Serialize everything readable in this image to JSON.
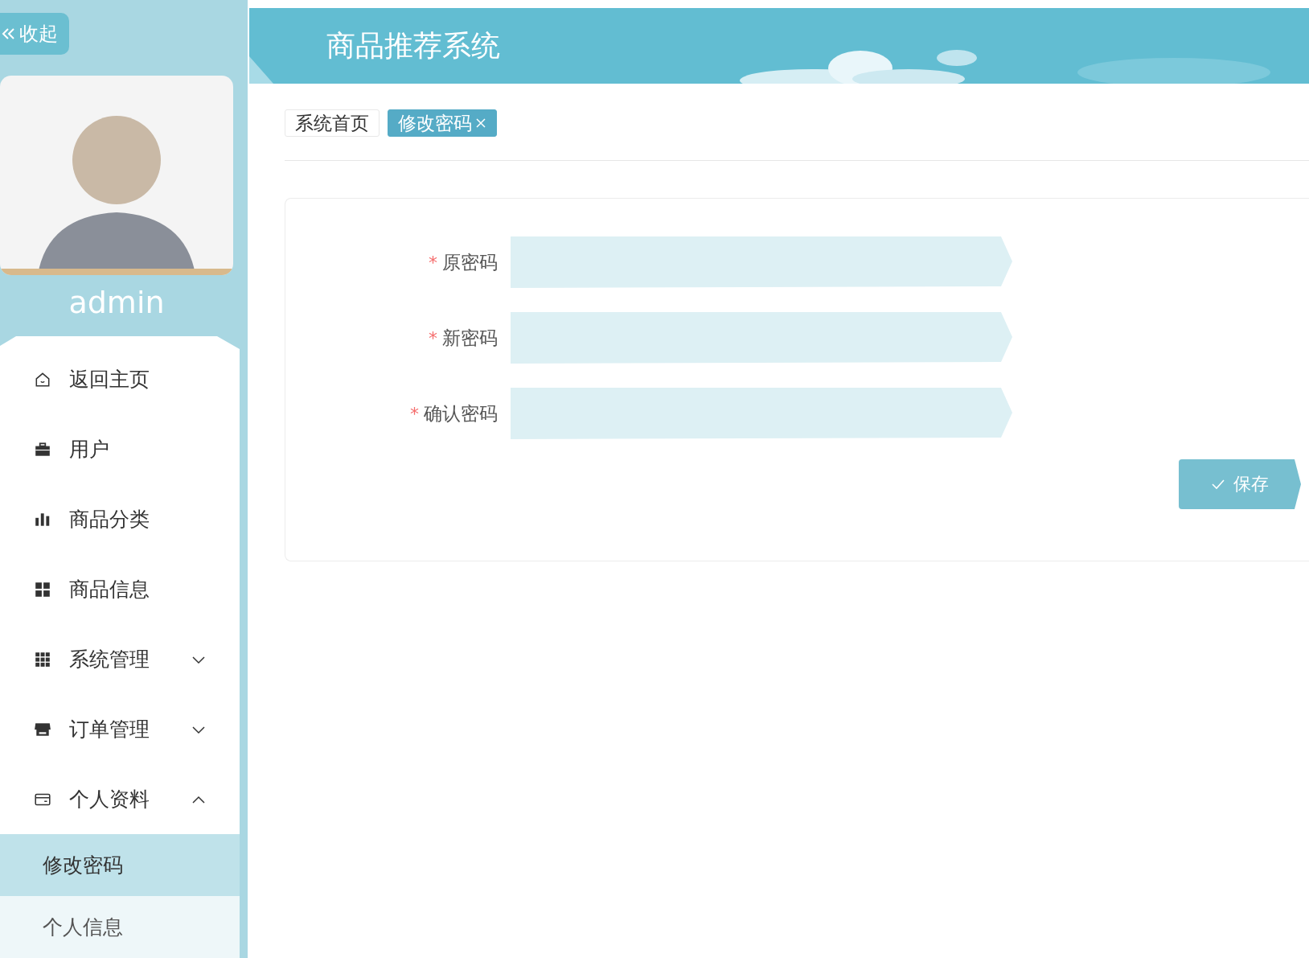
{
  "sidebar": {
    "collapse_button": {
      "label": "收起"
    },
    "user": {
      "name": "admin"
    },
    "menu": [
      {
        "label": "返回主页",
        "kind": "home"
      },
      {
        "label": "用户",
        "kind": "users"
      },
      {
        "label": "商品分类",
        "kind": "category"
      },
      {
        "label": "商品信息",
        "kind": "goods"
      },
      {
        "label": "系统管理",
        "kind": "system",
        "expanded": false
      },
      {
        "label": "订单管理",
        "kind": "orders",
        "expanded": false
      },
      {
        "label": "个人资料",
        "kind": "profile",
        "expanded": true,
        "children": [
          {
            "label": "修改密码",
            "selected": true
          },
          {
            "label": "个人信息",
            "selected": false
          }
        ]
      }
    ]
  },
  "header": {
    "title": "商品推荐系统"
  },
  "tabs": [
    {
      "label": "系统首页",
      "selected": false,
      "closable": false
    },
    {
      "label": "修改密码",
      "selected": true,
      "closable": true
    }
  ],
  "form": {
    "fields": [
      {
        "label": "原密码",
        "required_mark": "*"
      },
      {
        "label": "新密码",
        "required_mark": "*"
      },
      {
        "label": "确认密码",
        "required_mark": "*"
      }
    ],
    "save_button": {
      "label": "保存"
    }
  }
}
